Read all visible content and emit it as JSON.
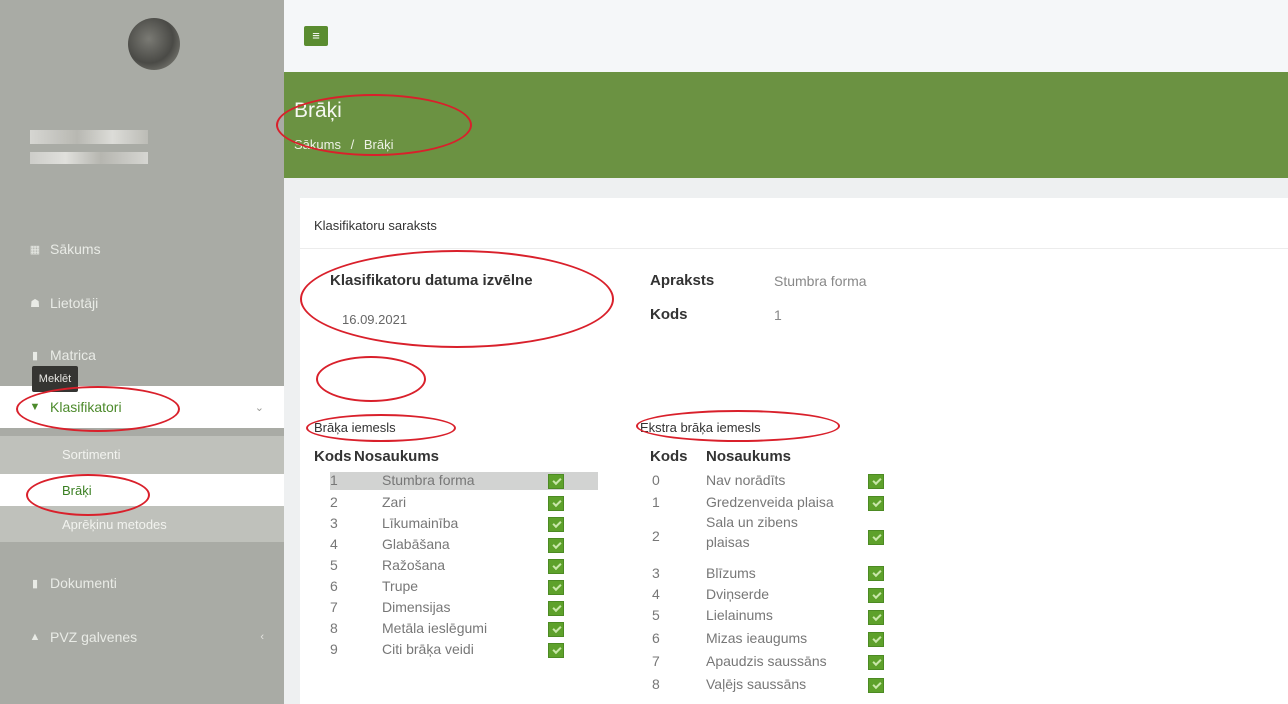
{
  "sidebar": {
    "items": [
      {
        "label": "Sākums",
        "icon": "dashboard-icon"
      },
      {
        "label": "Lietotāji",
        "icon": "users-icon"
      },
      {
        "label": "Matrica",
        "icon": "file-icon"
      },
      {
        "label": "Klasifikatori",
        "icon": "filter-icon",
        "arrow": "chevron-down-icon"
      },
      {
        "label": "Dokumenti",
        "icon": "file-icon"
      },
      {
        "label": "PVZ galvenes",
        "icon": "car-icon",
        "arrow": "chevron-left-icon"
      }
    ],
    "submenu": [
      "Sortimenti",
      "Brāķi",
      "Aprēķinu metodes"
    ]
  },
  "header": {
    "title": "Brāķi",
    "breadcrumb_home": "Sākums",
    "breadcrumb_sep": "/",
    "breadcrumb_current": "Brāķi"
  },
  "card": {
    "title": "Klasifikatoru saraksts",
    "date_label": "Klasifikatoru datuma izvēlne",
    "date_value": "16.09.2021",
    "desc_label": "Apraksts",
    "desc_value": "Stumbra forma",
    "code_label": "Kods",
    "code_value": "1",
    "search_button": "Meklēt"
  },
  "brakis": {
    "title": "Brāķa iemesls",
    "col_code": "Kods",
    "col_name": "Nosaukums",
    "rows": [
      {
        "code": "1",
        "name": "Stumbra forma"
      },
      {
        "code": "2",
        "name": "Zari"
      },
      {
        "code": "3",
        "name": "Līkumainība"
      },
      {
        "code": "4",
        "name": "Glabāšana"
      },
      {
        "code": "5",
        "name": "Ražošana"
      },
      {
        "code": "6",
        "name": "Trupe"
      },
      {
        "code": "7",
        "name": "Dimensijas"
      },
      {
        "code": "8",
        "name": "Metāla ieslēgumi"
      },
      {
        "code": "9",
        "name": "Citi brāķa veidi"
      }
    ]
  },
  "extra": {
    "title": "Ekstra brāķa iemesls",
    "col_code": "Kods",
    "col_name": "Nosaukums",
    "rows": [
      {
        "code": "0",
        "name": "Nav norādīts"
      },
      {
        "code": "1",
        "name": "Gredzenveida plaisa"
      },
      {
        "code": "2",
        "name": "Sala un zibens",
        "name2": "plaisas"
      },
      {
        "code": "3",
        "name": "Blīzums"
      },
      {
        "code": "4",
        "name": "Dviņserde"
      },
      {
        "code": "5",
        "name": "Lielainums"
      },
      {
        "code": "6",
        "name": "Mizas ieaugums"
      },
      {
        "code": "7",
        "name": "Apaudzis saussāns"
      },
      {
        "code": "8",
        "name": "Vaļējs saussāns"
      }
    ]
  }
}
